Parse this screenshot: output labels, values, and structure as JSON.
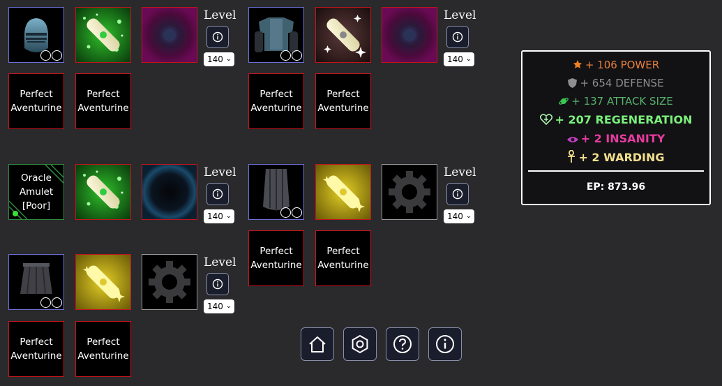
{
  "level_label": "Level",
  "level_value": "140",
  "slot_text": {
    "perfect": "Perfect",
    "aventurine": "Aventurine"
  },
  "amulet": {
    "line1": "Oracle",
    "line2": "Amulet",
    "line3": "[Poor]"
  },
  "icons": {
    "helmet": "knight-helmet-icon",
    "chest": "armor-chest-icon",
    "cloak": "cloak-icon",
    "legs": "leg-armor-icon",
    "scroll": "scroll-icon",
    "orb": "orb-icon",
    "gear": "gear-icon",
    "info": "info-icon",
    "home": "home-icon",
    "settings": "hexagon-settings-icon",
    "help": "question-icon"
  },
  "stats": {
    "power": "+ 106 POWER",
    "defense": "+ 654 DEFENSE",
    "attack_size": "+ 137 ATTACK SIZE",
    "regeneration": "+ 207 REGENERATION",
    "insanity": "+ 2 INSANITY",
    "warding": "+ 2 WARDING",
    "ep": "EP: 873.96"
  },
  "colors": {
    "power": "#e8803a",
    "defense": "#8e8e8e",
    "attack_size": "#57b06a",
    "regeneration": "#7bf07b",
    "insanity": "#e83ba0",
    "warding": "#f2df8c",
    "border_red": "#c4141c",
    "border_blue": "#6b6fd6",
    "border_green": "#2f8a3e"
  }
}
